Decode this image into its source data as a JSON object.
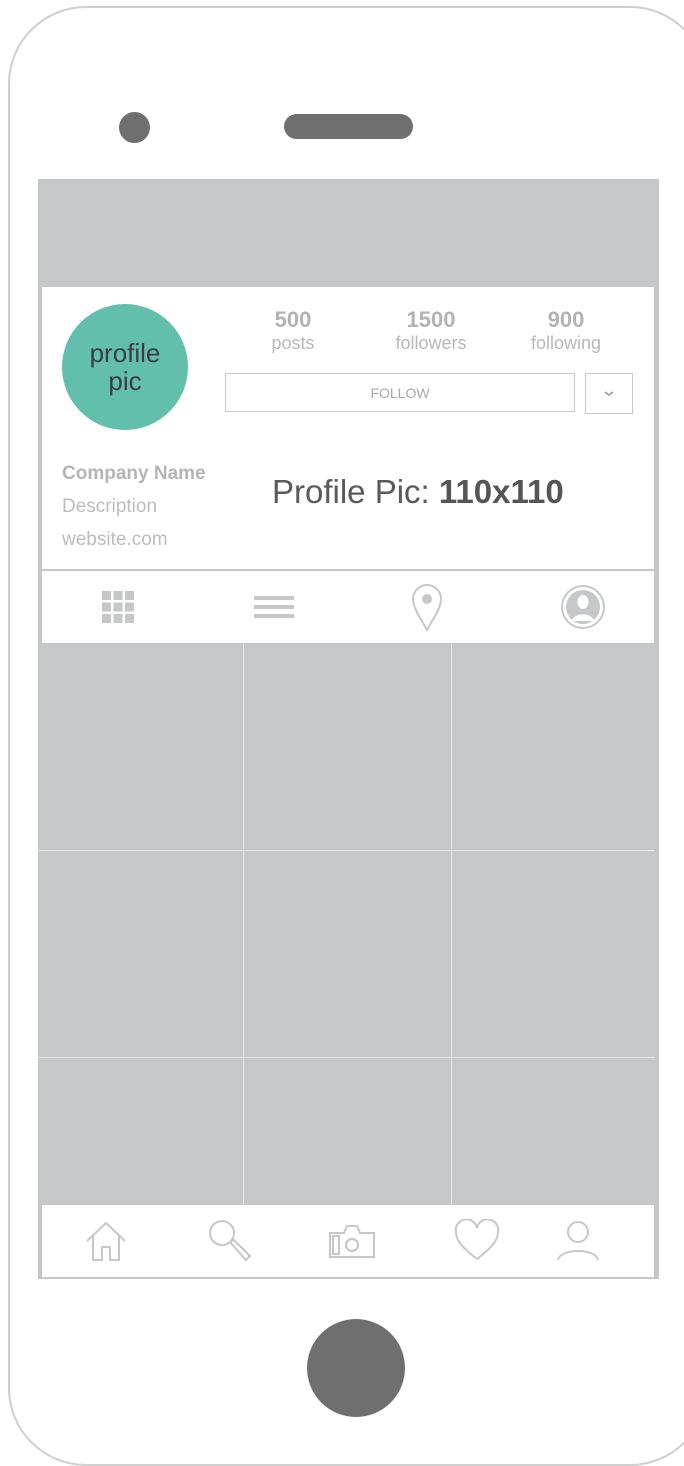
{
  "profile": {
    "avatar_line1": "profile",
    "avatar_line2": "pic",
    "stats": [
      {
        "value": "500",
        "label": "posts"
      },
      {
        "value": "1500",
        "label": "followers"
      },
      {
        "value": "900",
        "label": "following"
      }
    ],
    "follow_label": "FOLLOW",
    "company_name": "Company Name",
    "description": "Description",
    "website": "website.com",
    "spec_label": "Profile Pic: ",
    "spec_value": "110x110"
  },
  "tabs": [
    "grid-icon",
    "list-icon",
    "location-pin-icon",
    "user-circle-icon"
  ],
  "bottom_nav": [
    "home-icon",
    "search-icon",
    "camera-icon",
    "heart-icon",
    "profile-icon"
  ],
  "colors": {
    "placeholder": "#c6c7c9",
    "avatar": "#62bfac",
    "device": "#6f6f6f"
  }
}
